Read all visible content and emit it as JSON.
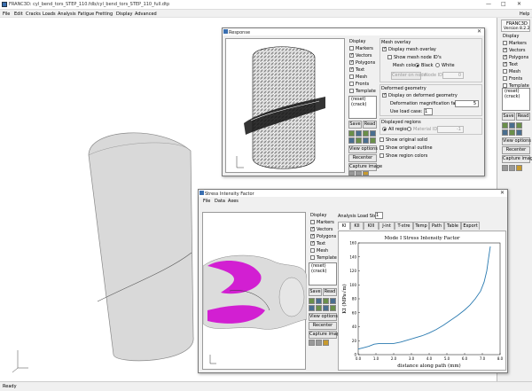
{
  "app": {
    "title": "FRANC3D: cyl_bend_tors_STEP_110.fdb/cyl_bend_tors_STEP_110_full.dtp",
    "menu": [
      "File",
      "Edit",
      "Cracks",
      "Loads",
      "Analysis",
      "Fatigue",
      "Fretting",
      "Display",
      "Advanced"
    ],
    "help": "Help",
    "status": "Ready"
  },
  "right_panel": {
    "version_name": "FRANC3D",
    "version_num": "Version 8.2.2",
    "display_label": "Display",
    "display_options": [
      {
        "label": "Markers",
        "checked": false
      },
      {
        "label": "Vectors",
        "checked": true
      },
      {
        "label": "Polygons",
        "checked": true
      },
      {
        "label": "Text",
        "checked": true
      },
      {
        "label": "Mesh",
        "checked": false
      },
      {
        "label": "Fronts",
        "checked": false
      },
      {
        "label": "Template",
        "checked": false
      }
    ],
    "list_items": [
      "(reset)",
      "(crack)"
    ],
    "save_label": "Save",
    "read_label": "Read",
    "view_options_label": "View options",
    "recenter_label": "Recenter",
    "capture_label": "Capture image"
  },
  "response": {
    "title": "Response",
    "display_label": "Display",
    "display_options": [
      {
        "label": "Markers",
        "checked": false
      },
      {
        "label": "Vectors",
        "checked": true
      },
      {
        "label": "Polygons",
        "checked": true
      },
      {
        "label": "Text",
        "checked": true
      },
      {
        "label": "Mesh",
        "checked": false
      },
      {
        "label": "Fronts",
        "checked": false
      },
      {
        "label": "Template",
        "checked": false
      }
    ],
    "list_items": [
      "(reset)",
      "(crack)"
    ],
    "save_label": "Save",
    "read_label": "Read",
    "view_options_label": "View options",
    "recenter_label": "Recenter",
    "capture_label": "Capture image",
    "mesh_overlay_heading": "Mesh overlay",
    "display_mesh_overlay": "Display mesh overlay",
    "show_mesh_node_ids": "Show mesh node ID's",
    "mesh_color_label": "Mesh color:",
    "mesh_color_black": "Black",
    "mesh_color_white": "White",
    "center_on_node": "Center on node",
    "node_id_label": "Node ID:",
    "node_id_value": "0",
    "deformed_heading": "Deformed geometry",
    "display_on_deformed": "Display on deformed geometry",
    "magnification_label": "Deformation magnification factor:",
    "magnification_value": "5",
    "load_case_label": "Use load case:",
    "load_case_value": "1",
    "displayed_regions_heading": "Displayed regions",
    "all_regions": "All regions",
    "material_id": "Material ID:",
    "material_id_value": "-1",
    "show_original_solid": "Show original solid",
    "show_original_outline": "Show original outline",
    "show_region_colors": "Show region colors"
  },
  "sif": {
    "title": "Stress Intensity Factor",
    "menu": [
      "File",
      "Data",
      "Axes"
    ],
    "display_label": "Display",
    "display_options": [
      {
        "label": "Markers",
        "checked": false
      },
      {
        "label": "Vectors",
        "checked": true
      },
      {
        "label": "Polygons",
        "checked": true
      },
      {
        "label": "Text",
        "checked": true
      },
      {
        "label": "Mesh",
        "checked": false
      },
      {
        "label": "Template",
        "checked": false
      }
    ],
    "list_items": [
      "(reset)",
      "(crack)"
    ],
    "save_label": "Save",
    "read_label": "Read",
    "view_options_label": "View options",
    "recenter_label": "Recenter",
    "capture_label": "Capture image",
    "load_step_label": "Analysis Load Step",
    "load_step_value": "1",
    "tabs": [
      "KI",
      "KII",
      "KIII",
      "J-int",
      "T-stre",
      "Temp",
      "Path",
      "Table",
      "Export"
    ]
  },
  "chart_data": {
    "type": "line",
    "title": "Mode I Stress Intensity Factor",
    "xlabel": "distance along path (mm)",
    "ylabel": "KI (MPa√m)",
    "xlim": [
      0,
      8
    ],
    "ylim": [
      0,
      160
    ],
    "x_ticks": [
      "0.0",
      "1.0",
      "2.0",
      "3.0",
      "4.0",
      "5.0",
      "6.0",
      "7.0",
      "8.0"
    ],
    "y_ticks": [
      "0",
      "20",
      "40",
      "60",
      "80",
      "100",
      "120",
      "140",
      "160"
    ],
    "grid": false,
    "series": [
      {
        "color": "#2a7ab0",
        "x": [
          0.0,
          0.3,
          0.6,
          0.9,
          1.2,
          1.6,
          2.0,
          2.4,
          2.8,
          3.2,
          3.6,
          4.0,
          4.4,
          4.8,
          5.2,
          5.6,
          6.0,
          6.3,
          6.6,
          6.9,
          7.1,
          7.25,
          7.35,
          7.45
        ],
        "y": [
          8,
          10,
          12,
          15,
          16,
          16,
          16,
          18,
          21,
          24,
          27,
          31,
          36,
          42,
          49,
          56,
          64,
          71,
          80,
          91,
          104,
          120,
          138,
          155
        ]
      }
    ]
  },
  "colors": {
    "crack_magenta": "#d21fd2",
    "model_gray": "#d9d9d9",
    "plot_line": "#2a7ab0"
  }
}
